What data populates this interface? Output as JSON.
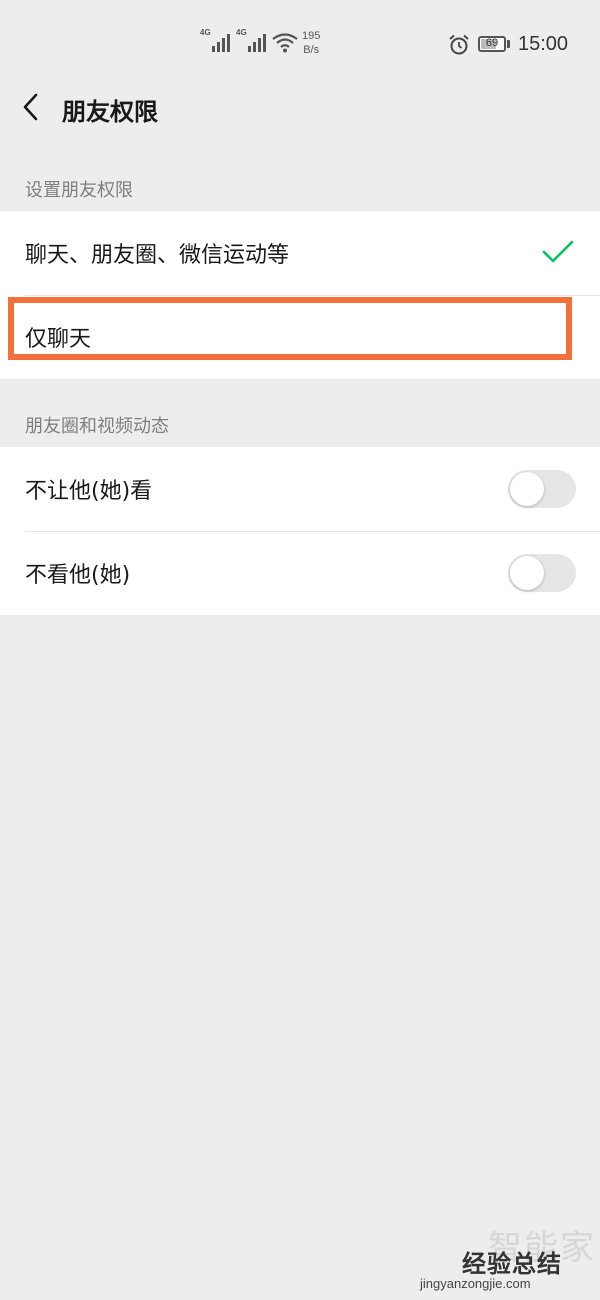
{
  "status_bar": {
    "signal1_label": "4G",
    "signal2_label": "4G",
    "speed_value": "195",
    "speed_unit": "B/s",
    "battery_level": "69",
    "time": "15:00"
  },
  "header": {
    "title": "朋友权限",
    "back_icon": "chevron-left-icon"
  },
  "permissions_section": {
    "label": "设置朋友权限",
    "options": [
      {
        "label": "聊天、朋友圈、微信运动等",
        "selected": true
      },
      {
        "label": "仅聊天",
        "selected": false
      }
    ]
  },
  "moments_section": {
    "label": "朋友圈和视频动态",
    "toggles": [
      {
        "label": "不让他(她)看",
        "on": false
      },
      {
        "label": "不看他(她)",
        "on": false
      }
    ]
  },
  "watermark": {
    "text_faded": "智能家",
    "text_main": "经验总结",
    "url": "jingyanzongjie.com"
  },
  "colors": {
    "background": "#ededed",
    "check": "#07c160",
    "highlight": "#f4703a",
    "toggle_off": "#e6e6e6"
  }
}
